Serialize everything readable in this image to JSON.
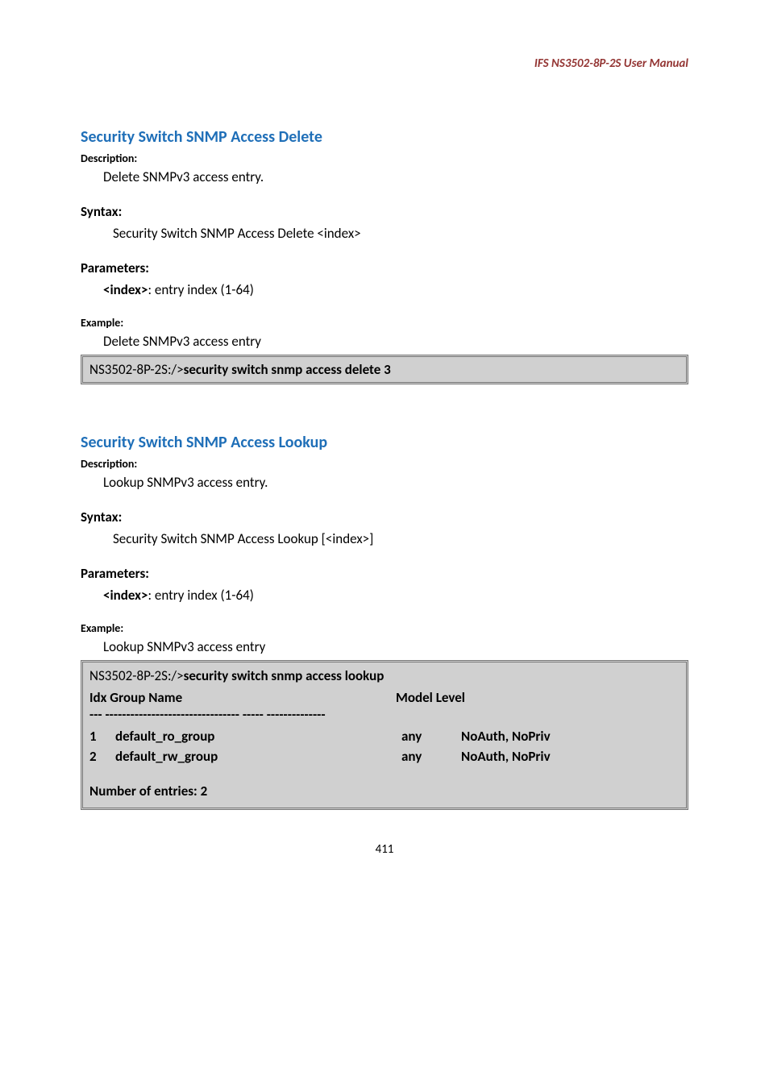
{
  "header": {
    "product_line": "IFS  NS3502-8P-2S  User  Manual"
  },
  "section1": {
    "heading": "Security Switch SNMP Access Delete",
    "desc_label": "Description:",
    "desc_text": "Delete SNMPv3 access entry.",
    "syntax_label": "Syntax:",
    "syntax_text": "Security Switch SNMP Access Delete <index>",
    "params_label": "Parameters:",
    "param_key": "<index>",
    "param_rest": ": entry index (1-64)",
    "example_label": "Example:",
    "example_text": "Delete SNMPv3 access entry",
    "code_prefix": "NS3502-8P-2S:/>",
    "code_cmd": "security switch snmp access delete 3"
  },
  "section2": {
    "heading": "Security Switch SNMP Access Lookup",
    "desc_label": "Description:",
    "desc_text": "Lookup SNMPv3 access entry.",
    "syntax_label": "Syntax:",
    "syntax_text": "Security Switch SNMP Access Lookup [<index>]",
    "params_label": "Parameters:",
    "param_key": "<index>",
    "param_rest": ": entry index (1-64)",
    "example_label": "Example:",
    "example_text": "Lookup SNMPv3 access entry",
    "code_prefix": "NS3502-8P-2S:/>",
    "code_cmd": "security switch snmp access lookup",
    "hdr_group": "Idx Group Name",
    "hdr_level": "Model Level",
    "dash_line": "--- -------------------------------- ----- --------------",
    "rows": [
      {
        "idx": "1",
        "name": "default_ro_group",
        "model": "any",
        "level": "NoAuth, NoPriv"
      },
      {
        "idx": "2",
        "name": "default_rw_group",
        "model": "any",
        "level": "NoAuth, NoPriv"
      }
    ],
    "entries_line": "Number of entries: 2"
  },
  "page_number": "411"
}
